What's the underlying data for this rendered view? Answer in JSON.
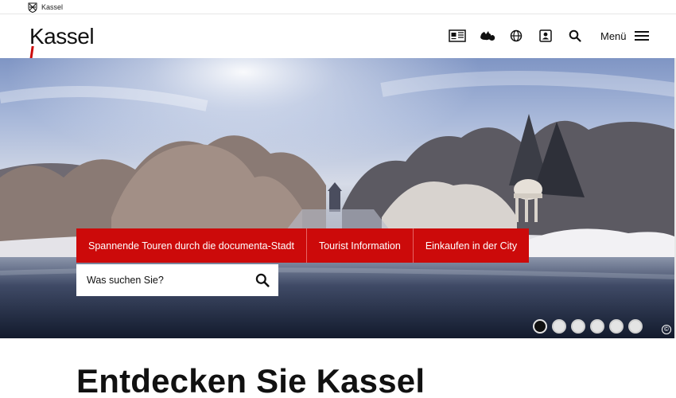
{
  "topstrip": {
    "city_label": "Kassel"
  },
  "header": {
    "logo_text": "Kassel",
    "icons": [
      {
        "name": "easy-language-icon"
      },
      {
        "name": "sign-language-icon"
      },
      {
        "name": "language-globe-icon"
      },
      {
        "name": "account-icon"
      },
      {
        "name": "search-icon"
      }
    ],
    "menu_label": "Menü"
  },
  "hero": {
    "quick_links": [
      {
        "label": "Spannende Touren durch die documenta-Stadt"
      },
      {
        "label": "Tourist Information"
      },
      {
        "label": "Einkaufen in der City"
      }
    ],
    "search": {
      "placeholder": "Was suchen Sie?",
      "value": ""
    },
    "slider": {
      "slide_count": 6,
      "active_index": 0
    },
    "copyright_symbol": "©"
  },
  "main": {
    "heading": "Entdecken Sie Kassel"
  },
  "colors": {
    "brand_red": "#cc0a0a",
    "text": "#111111"
  }
}
